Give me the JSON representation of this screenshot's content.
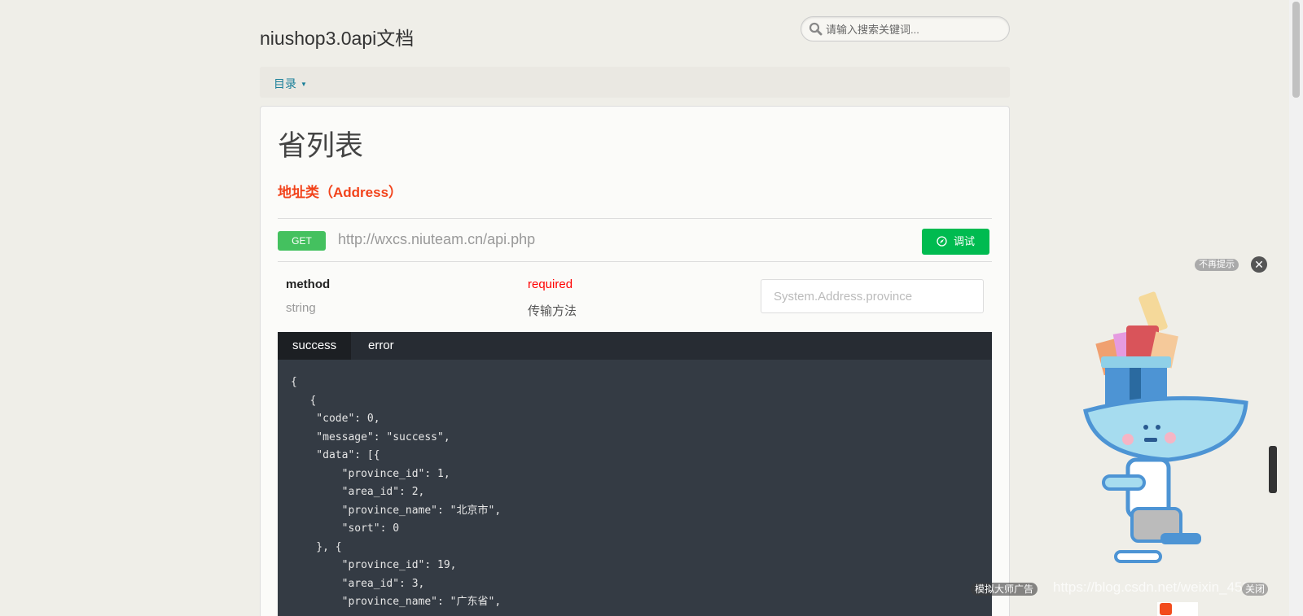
{
  "header": {
    "title": "niushop3.0api文档",
    "search_placeholder": "请输入搜索关键词..."
  },
  "nav": {
    "menu_label": "目录",
    "caret": "▼"
  },
  "page": {
    "title": "省列表",
    "category": "地址类（Address）"
  },
  "endpoint": {
    "method": "GET",
    "url": "http://wxcs.niuteam.cn/api.php",
    "debug_label": "调试"
  },
  "params": [
    {
      "name": "method",
      "type": "string",
      "required": "required",
      "description": "传输方法",
      "placeholder": "System.Address.province"
    }
  ],
  "response": {
    "tabs": [
      {
        "label": "success",
        "active": true
      },
      {
        "label": "error",
        "active": false
      }
    ],
    "code": "{\n   {\n    \"code\": 0,\n    \"message\": \"success\",\n    \"data\": [{\n        \"province_id\": 1,\n        \"area_id\": 2,\n        \"province_name\": \"北京市\",\n        \"sort\": 0\n    }, {\n        \"province_id\": 19,\n        \"area_id\": 3,\n        \"province_name\": \"广东省\","
  },
  "ad": {
    "no_more": "不再提示",
    "close": "✕",
    "label": "模拟大师广告",
    "close_text": "关闭",
    "watermark": "https://blog.csdn.net/weixin_45932"
  },
  "colors": {
    "accent": "#1a7f99",
    "category": "#f2431b",
    "get": "#44c15f",
    "debug": "#00bb50",
    "required": "#ff0000",
    "code_bg": "#343b44"
  }
}
